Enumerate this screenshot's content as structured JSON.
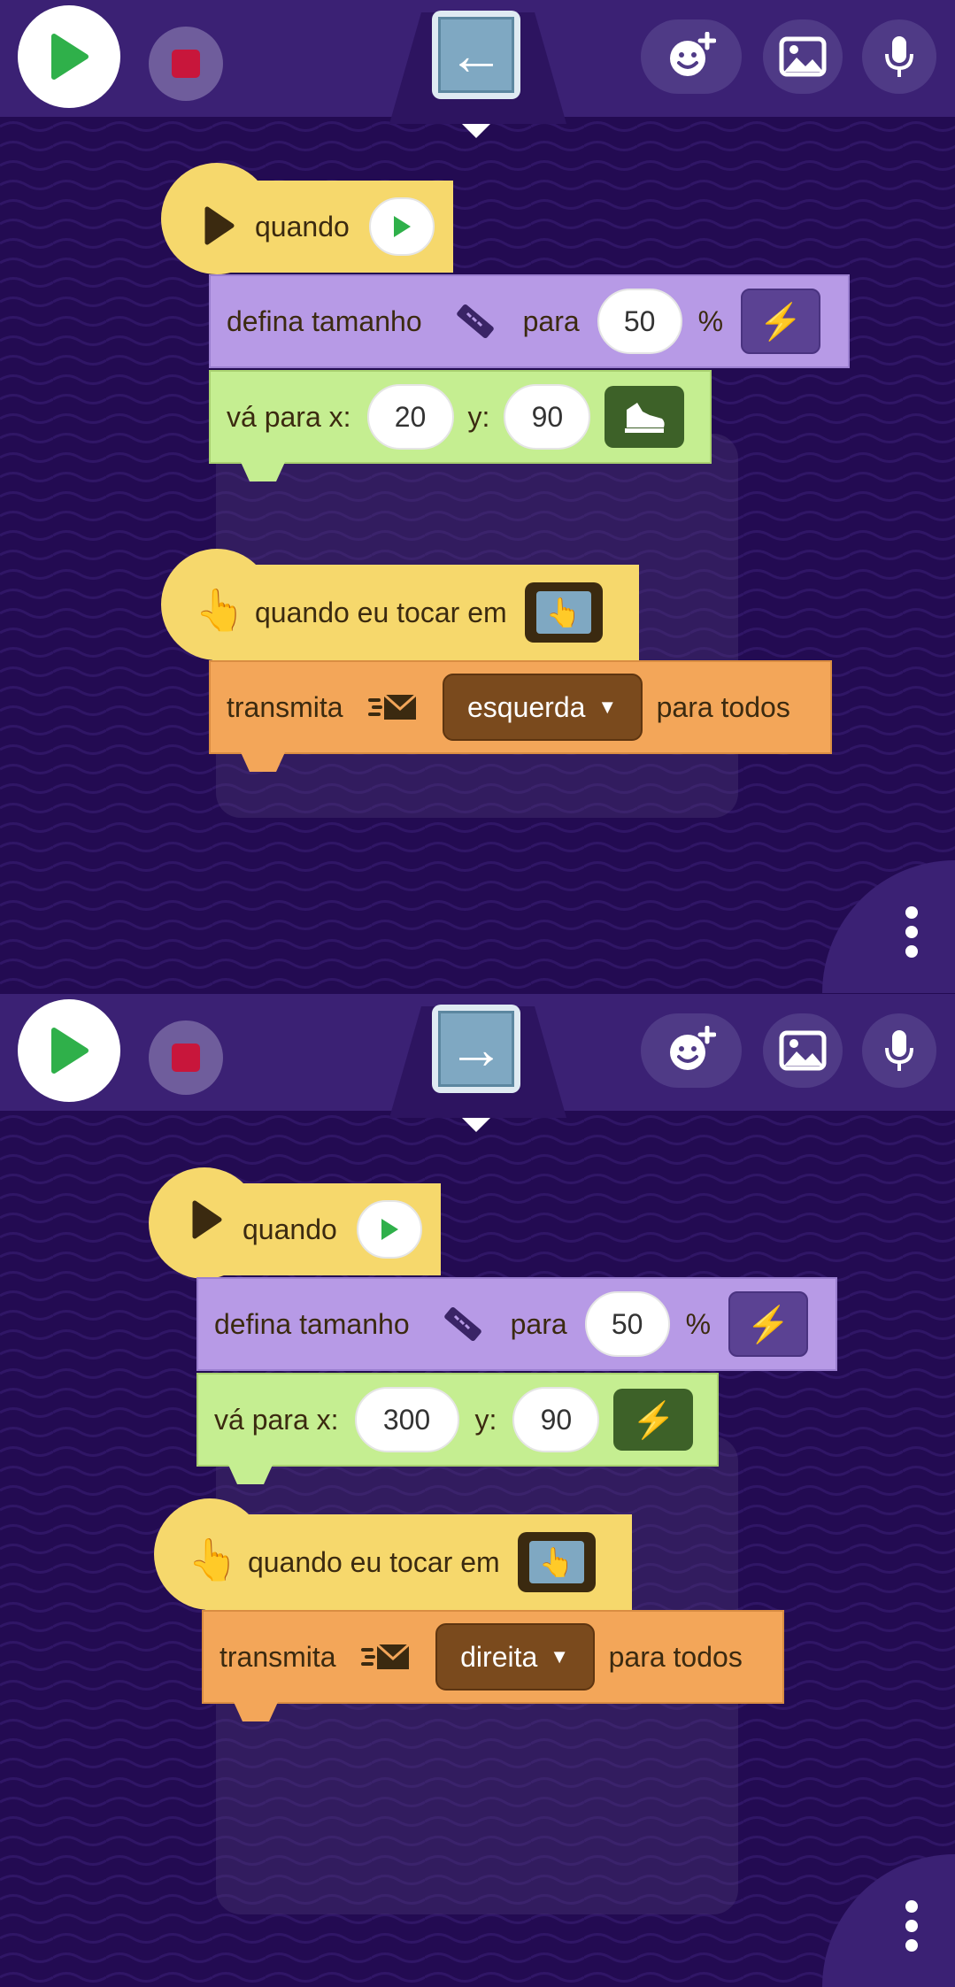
{
  "panels": [
    {
      "sprite_arrow": "←",
      "script": {
        "hat1_label": "quando",
        "size_label": "defina tamanho",
        "size_para": "para",
        "size_value": "50",
        "size_percent": "%",
        "goto_label": "vá para x:",
        "goto_x": "20",
        "goto_y_label": "y:",
        "goto_y": "90",
        "hat2_label": "quando eu tocar em",
        "broadcast_label": "transmita",
        "broadcast_value": "esquerda",
        "broadcast_suffix": "para todos"
      }
    },
    {
      "sprite_arrow": "→",
      "script": {
        "hat1_label": "quando",
        "size_label": "defina tamanho",
        "size_para": "para",
        "size_value": "50",
        "size_percent": "%",
        "goto_label": "vá para x:",
        "goto_x": "300",
        "goto_y_label": "y:",
        "goto_y": "90",
        "hat2_label": "quando eu tocar em",
        "broadcast_label": "transmita",
        "broadcast_value": "direita",
        "broadcast_suffix": "para todos"
      }
    }
  ],
  "icons": {
    "play": "play-icon",
    "stop": "stop-icon",
    "add_sprite": "add-sprite-icon",
    "backdrop": "image-icon",
    "sound": "microphone-icon",
    "menu": "more-vertical-icon"
  },
  "colors": {
    "background": "#230b52",
    "topbar": "#3b2174",
    "hat_block": "#f6d86c",
    "looks_block": "#b79ae6",
    "motion_block": "#c5ee91",
    "events_block": "#f3a659",
    "play_green": "#2fb04a",
    "stop_red": "#c8163b"
  }
}
